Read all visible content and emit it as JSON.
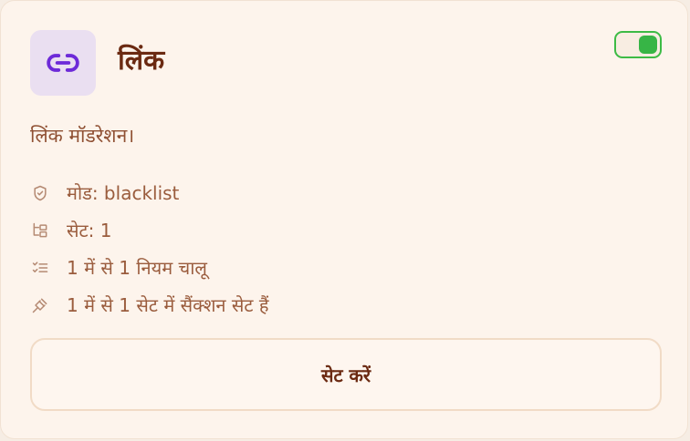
{
  "card": {
    "title": "लिंक",
    "icon": "link-icon",
    "enabled": true,
    "description": "लिंक मॉडरेशन।",
    "meta": [
      {
        "icon": "shield-icon",
        "text": "मोड: blacklist"
      },
      {
        "icon": "sets-icon",
        "text": "सेट: 1"
      },
      {
        "icon": "checklist-icon",
        "text": "1 में से 1 नियम चालू"
      },
      {
        "icon": "gavel-icon",
        "text": "1 में से 1 सेट में सैंक्शन सेट हैं"
      }
    ],
    "button_label": "सेट करें"
  },
  "colors": {
    "accent_purple": "#6d2ad8",
    "toggle_green": "#37b546",
    "title": "#6b2a12",
    "text": "#9a5c3d"
  }
}
